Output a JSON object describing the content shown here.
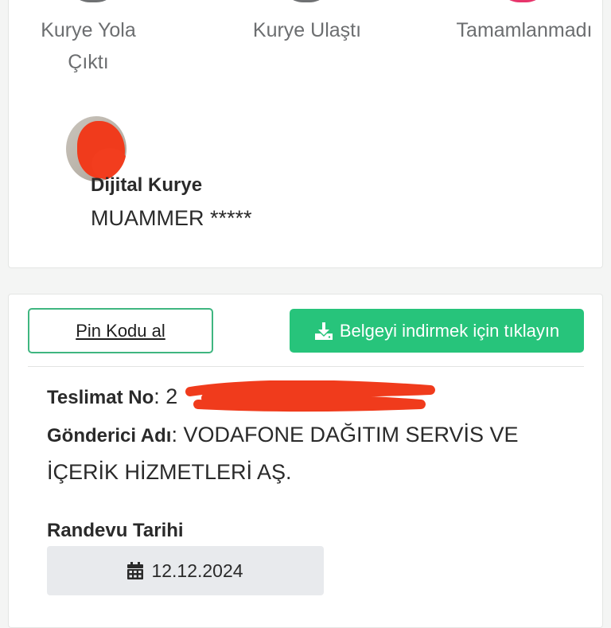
{
  "tracking": {
    "steps": [
      {
        "label_line1": "Kurye Yola",
        "label_line2": "Çıktı",
        "indicator": "gray"
      },
      {
        "label_line1": "Kurye Ulaştı",
        "label_line2": "",
        "indicator": "gray"
      },
      {
        "label_line1": "Tamamlanmadı",
        "label_line2": "",
        "indicator": "pink"
      }
    ],
    "courier": {
      "title": "Dijital Kurye",
      "name": "MUAMMER *****"
    }
  },
  "delivery": {
    "pin_button_label": "Pin Kodu al",
    "download_button_label": "Belgeyi indirmek için tıklayın",
    "delivery_no_label": "Teslimat No",
    "delivery_no_value": "2",
    "sender_label": "Gönderici Adı",
    "sender_line1": "VODAFONE DAĞITIM SERVİS VE",
    "sender_line2": "İÇERİK HİZMETLERİ AŞ.",
    "appointment_label": "Randevu Tarihi",
    "appointment_date": "12.12.2024"
  },
  "colors": {
    "accent_green": "#27c47b",
    "pin_border": "#3fb680",
    "step_gray": "#6f7173",
    "step_pink": "#e7356b",
    "redaction": "#f03b1c"
  },
  "icons": {
    "download": "download-icon",
    "calendar": "calendar-icon"
  }
}
